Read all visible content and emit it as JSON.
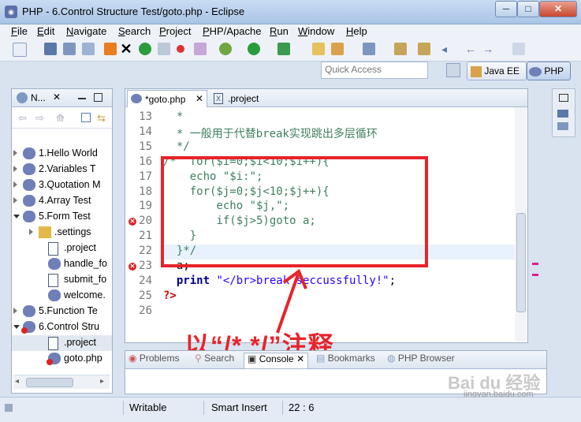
{
  "window": {
    "title": "PHP - 6.Control Structure Test/goto.php - Eclipse",
    "minimize": "─",
    "maximize": "□",
    "close": "✕"
  },
  "menu": [
    "File",
    "Edit",
    "Navigate",
    "Search",
    "Project",
    "PHP/Apache",
    "Run",
    "Window",
    "Help"
  ],
  "menu_mnemonic": [
    "F",
    "E",
    "N",
    "S",
    "P",
    "P",
    "R",
    "W",
    "H"
  ],
  "quick_access": {
    "placeholder": "Quick Access"
  },
  "perspectives": {
    "java": "Java EE",
    "php": "PHP"
  },
  "navigator": {
    "tab_label": "N...",
    "items": [
      {
        "label": "1.Hello World",
        "expanded": false,
        "kind": "project"
      },
      {
        "label": "2.Variables T",
        "expanded": false,
        "kind": "project"
      },
      {
        "label": "3.Quotation M",
        "expanded": false,
        "kind": "project"
      },
      {
        "label": "4.Array Test",
        "expanded": false,
        "kind": "project"
      },
      {
        "label": "5.Form Test",
        "expanded": true,
        "kind": "project"
      },
      {
        "label": ".settings",
        "expanded": false,
        "kind": "folder"
      },
      {
        "label": ".project",
        "kind": "xfile"
      },
      {
        "label": "handle_fo",
        "kind": "php"
      },
      {
        "label": "submit_fo",
        "kind": "file"
      },
      {
        "label": "welcome.",
        "kind": "php"
      },
      {
        "label": "5.Function Te",
        "expanded": false,
        "kind": "project"
      },
      {
        "label": "6.Control Stru",
        "expanded": true,
        "kind": "project-error"
      },
      {
        "label": ".project",
        "kind": "xfile",
        "selected": true
      },
      {
        "label": "goto.php",
        "kind": "php-error"
      }
    ]
  },
  "editor": {
    "tabs": [
      {
        "label": "*goto.php",
        "active": true
      },
      {
        "label": ".project",
        "active": false
      }
    ],
    "lines": [
      {
        "n": "13",
        "text": "  *",
        "cls": "c-green"
      },
      {
        "n": "14",
        "text": "  * 一般用于代替break实现跳出多层循环",
        "cls": "c-green"
      },
      {
        "n": "15",
        "text": "  */",
        "cls": "c-green"
      },
      {
        "n": "16",
        "text": "/*  for($i=0;$i<10;$i++){",
        "cls": "c-green"
      },
      {
        "n": "17",
        "text": "    echo \"$i:\";",
        "cls": "c-green"
      },
      {
        "n": "18",
        "text": "    for($j=0;$j<10;$j++){",
        "cls": "c-green"
      },
      {
        "n": "19",
        "text": "        echo \"$j,\";",
        "cls": "c-green"
      },
      {
        "n": "20",
        "text": "        if($j>5)goto a;",
        "cls": "c-green",
        "error": true
      },
      {
        "n": "21",
        "text": "    }",
        "cls": "c-green"
      },
      {
        "n": "22",
        "text": "  }*/",
        "cls": "c-green",
        "current": true
      },
      {
        "n": "23",
        "text": "  a;",
        "cls": "c-default",
        "error": true
      },
      {
        "n": "24",
        "text": "  print \"</br>break seccussfully!\";",
        "cls": "mixed"
      },
      {
        "n": "25",
        "text": "?>",
        "cls": "c-tag"
      },
      {
        "n": "26",
        "text": "",
        "cls": "c-default"
      }
    ]
  },
  "annotation": "以“/* */”注释",
  "bottom_tabs": [
    "Problems",
    "Search",
    "Console",
    "Bookmarks",
    "PHP Browser"
  ],
  "status": {
    "writable": "Writable",
    "insert_mode": "Smart Insert",
    "position": "22 : 6"
  },
  "watermark": {
    "brand": "Bai du 经验",
    "url": "jingyan.baidu.com"
  },
  "colors": {
    "annotation_red": "#e8232a",
    "comment_green": "#3f7f5f",
    "string_blue": "#2a00ff"
  }
}
